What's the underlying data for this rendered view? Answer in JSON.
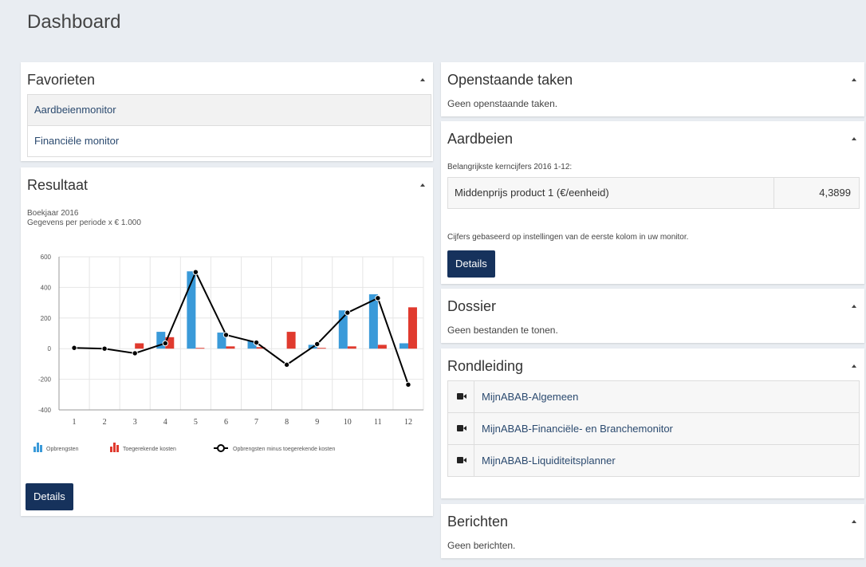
{
  "page": {
    "title": "Dashboard"
  },
  "colors": {
    "primary_button": "#16325c",
    "bar_opbrengsten": "#3a9ad9",
    "bar_kosten": "#e03a2e",
    "line": "#000000"
  },
  "favorieten": {
    "title": "Favorieten",
    "items": [
      "Aardbeienmonitor",
      "Financiële monitor"
    ]
  },
  "resultaat": {
    "title": "Resultaat",
    "subtitle_1": "Boekjaar 2016",
    "subtitle_2": "Gegevens per periode x € 1.000",
    "details_label": "Details"
  },
  "chart_data": {
    "type": "bar",
    "categories": [
      "1",
      "2",
      "3",
      "4",
      "5",
      "6",
      "7",
      "8",
      "9",
      "10",
      "11",
      "12"
    ],
    "series": [
      {
        "name": "Opbrengsten",
        "type": "bar",
        "color": "#3a9ad9",
        "values": [
          0,
          0,
          0,
          110,
          505,
          105,
          50,
          0,
          25,
          250,
          355,
          35
        ]
      },
      {
        "name": "Toegerekende kosten",
        "type": "bar",
        "color": "#e03a2e",
        "values": [
          0,
          0,
          35,
          75,
          5,
          15,
          10,
          110,
          5,
          15,
          25,
          270
        ]
      },
      {
        "name": "Opbrengsten minus toegerekende kosten",
        "type": "line",
        "color": "#000000",
        "values": [
          5,
          0,
          -30,
          35,
          500,
          90,
          40,
          -105,
          30,
          235,
          330,
          -235
        ]
      }
    ],
    "ylim": [
      -400,
      600
    ],
    "yticks": [
      600,
      400,
      200,
      0,
      -200,
      -400
    ],
    "grid": true,
    "legend": "bottom-left"
  },
  "openstaande_taken": {
    "title": "Openstaande taken",
    "text": "Geen openstaande taken."
  },
  "aardbeien": {
    "title": "Aardbeien",
    "intro": "Belangrijkste kerncijfers 2016 1-12:",
    "kpi_label": "Middenprijs product 1 (€/eenheid)",
    "kpi_value": "4,3899",
    "note": "Cijfers gebaseerd op instellingen van de eerste kolom in uw monitor.",
    "details_label": "Details"
  },
  "dossier": {
    "title": "Dossier",
    "text": "Geen bestanden te tonen."
  },
  "rondleiding": {
    "title": "Rondleiding",
    "items": [
      "MijnABAB-Algemeen",
      "MijnABAB-Financiële- en Branchemonitor",
      "MijnABAB-Liquiditeitsplanner"
    ],
    "icon": "video-camera-icon"
  },
  "berichten": {
    "title": "Berichten",
    "text": "Geen berichten."
  }
}
